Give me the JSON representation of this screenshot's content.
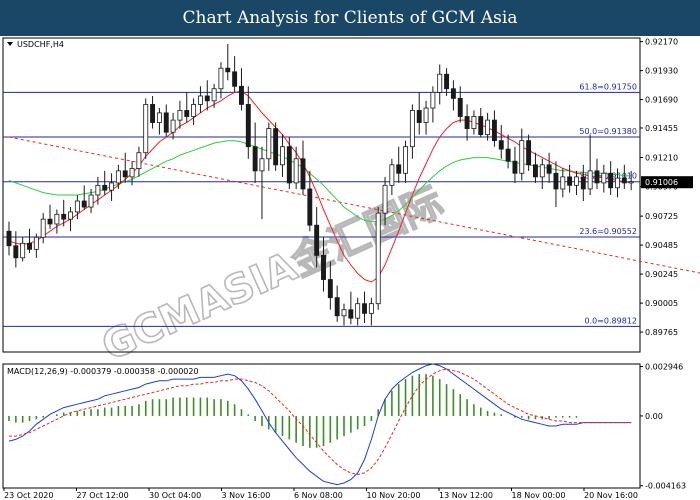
{
  "header": {
    "title": "Chart Analysis for Clients of GCM Asia"
  },
  "chart_data": {
    "type": "candlestick",
    "symbol_label": "USDCHF,H4",
    "watermark": "GCMASIA金汇国际",
    "price_axis": {
      "ylim": [
        0.896,
        0.922
      ],
      "ticks": [
        "0.92170",
        "0.91930",
        "0.91690",
        "0.91455",
        "0.91210",
        "0.90970",
        "0.90725",
        "0.90485",
        "0.90245",
        "0.90005",
        "0.89765"
      ]
    },
    "current_price": "0.91006",
    "fibonacci": [
      {
        "label": "61.8=0.91750",
        "price": 0.9175
      },
      {
        "label": "50.0=0.91380",
        "price": 0.9138
      },
      {
        "label": "38.2=0.91010",
        "price": 0.9101
      },
      {
        "label": "23.6=0.90552",
        "price": 0.90552
      },
      {
        "label": "0.0=0.89812",
        "price": 0.89812
      }
    ],
    "trendline": {
      "from": [
        0,
        0.9138
      ],
      "to": [
        140,
        0.8982
      ]
    },
    "candles": [
      [
        0.906,
        0.9068,
        0.904,
        0.9048
      ],
      [
        0.9048,
        0.906,
        0.903,
        0.9038
      ],
      [
        0.9038,
        0.9055,
        0.9035,
        0.905
      ],
      [
        0.905,
        0.9062,
        0.9042,
        0.9045
      ],
      [
        0.9045,
        0.9058,
        0.9038,
        0.9055
      ],
      [
        0.9055,
        0.9075,
        0.905,
        0.907
      ],
      [
        0.907,
        0.9082,
        0.9062,
        0.9066
      ],
      [
        0.9066,
        0.9078,
        0.9058,
        0.9074
      ],
      [
        0.9074,
        0.9086,
        0.9064,
        0.907
      ],
      [
        0.907,
        0.908,
        0.906,
        0.9076
      ],
      [
        0.9076,
        0.909,
        0.907,
        0.9085
      ],
      [
        0.9085,
        0.9098,
        0.9078,
        0.908
      ],
      [
        0.908,
        0.9095,
        0.9075,
        0.909
      ],
      [
        0.909,
        0.9105,
        0.9082,
        0.9098
      ],
      [
        0.9098,
        0.911,
        0.909,
        0.9094
      ],
      [
        0.9094,
        0.9108,
        0.9085,
        0.91
      ],
      [
        0.91,
        0.9115,
        0.9095,
        0.911
      ],
      [
        0.911,
        0.9125,
        0.91,
        0.9105
      ],
      [
        0.9105,
        0.9118,
        0.9098,
        0.9112
      ],
      [
        0.9112,
        0.913,
        0.9105,
        0.9125
      ],
      [
        0.9125,
        0.917,
        0.912,
        0.9165
      ],
      [
        0.9165,
        0.9172,
        0.9145,
        0.915
      ],
      [
        0.915,
        0.9162,
        0.914,
        0.9158
      ],
      [
        0.9158,
        0.9165,
        0.9138,
        0.9142
      ],
      [
        0.9142,
        0.9158,
        0.9136,
        0.9152
      ],
      [
        0.9152,
        0.9168,
        0.9145,
        0.916
      ],
      [
        0.916,
        0.9175,
        0.915,
        0.9155
      ],
      [
        0.9155,
        0.917,
        0.9148,
        0.9165
      ],
      [
        0.9165,
        0.918,
        0.9158,
        0.9172
      ],
      [
        0.9172,
        0.9185,
        0.916,
        0.9168
      ],
      [
        0.9168,
        0.9182,
        0.9162,
        0.9178
      ],
      [
        0.9178,
        0.92,
        0.917,
        0.9195
      ],
      [
        0.9195,
        0.9215,
        0.9185,
        0.9192
      ],
      [
        0.9192,
        0.9205,
        0.9175,
        0.918
      ],
      [
        0.918,
        0.9195,
        0.916,
        0.9165
      ],
      [
        0.9165,
        0.918,
        0.912,
        0.913
      ],
      [
        0.913,
        0.915,
        0.91,
        0.911
      ],
      [
        0.911,
        0.913,
        0.907,
        0.912
      ],
      [
        0.912,
        0.915,
        0.911,
        0.9145
      ],
      [
        0.9145,
        0.915,
        0.911,
        0.9115
      ],
      [
        0.9115,
        0.914,
        0.9105,
        0.913
      ],
      [
        0.913,
        0.9138,
        0.9095,
        0.91
      ],
      [
        0.91,
        0.913,
        0.9095,
        0.912
      ],
      [
        0.912,
        0.9135,
        0.909,
        0.9095
      ],
      [
        0.9095,
        0.911,
        0.906,
        0.9065
      ],
      [
        0.9065,
        0.908,
        0.903,
        0.904
      ],
      [
        0.904,
        0.9055,
        0.901,
        0.902
      ],
      [
        0.902,
        0.9035,
        0.8995,
        0.9005
      ],
      [
        0.9005,
        0.9015,
        0.8985,
        0.899
      ],
      [
        0.899,
        0.9,
        0.8982,
        0.8995
      ],
      [
        0.8995,
        0.901,
        0.8983,
        0.8988
      ],
      [
        0.8988,
        0.9005,
        0.8982,
        0.9
      ],
      [
        0.9,
        0.901,
        0.8984,
        0.8992
      ],
      [
        0.8992,
        0.9005,
        0.8982,
        0.9
      ],
      [
        0.9,
        0.908,
        0.8995,
        0.9075
      ],
      [
        0.9075,
        0.9105,
        0.9065,
        0.9098
      ],
      [
        0.9098,
        0.912,
        0.909,
        0.9115
      ],
      [
        0.9115,
        0.913,
        0.91,
        0.9108
      ],
      [
        0.9108,
        0.9135,
        0.91,
        0.913
      ],
      [
        0.913,
        0.9165,
        0.912,
        0.916
      ],
      [
        0.916,
        0.9175,
        0.914,
        0.915
      ],
      [
        0.915,
        0.9168,
        0.914,
        0.9162
      ],
      [
        0.9162,
        0.918,
        0.915,
        0.9175
      ],
      [
        0.9175,
        0.9198,
        0.9165,
        0.919
      ],
      [
        0.919,
        0.9195,
        0.9172,
        0.9178
      ],
      [
        0.9178,
        0.9185,
        0.916,
        0.917
      ],
      [
        0.917,
        0.918,
        0.915,
        0.9155
      ],
      [
        0.9155,
        0.9165,
        0.9135,
        0.9145
      ],
      [
        0.9145,
        0.916,
        0.914,
        0.9155
      ],
      [
        0.9155,
        0.9162,
        0.9138,
        0.914
      ],
      [
        0.914,
        0.9158,
        0.9135,
        0.9152
      ],
      [
        0.9152,
        0.916,
        0.913,
        0.9135
      ],
      [
        0.9135,
        0.9148,
        0.912,
        0.9128
      ],
      [
        0.9128,
        0.914,
        0.9112,
        0.9118
      ],
      [
        0.9118,
        0.913,
        0.91,
        0.9108
      ],
      [
        0.9108,
        0.9145,
        0.9102,
        0.9135
      ],
      [
        0.9135,
        0.914,
        0.911,
        0.9115
      ],
      [
        0.9115,
        0.9125,
        0.91,
        0.9105
      ],
      [
        0.9105,
        0.912,
        0.9095,
        0.9115
      ],
      [
        0.9115,
        0.9125,
        0.91,
        0.9108
      ],
      [
        0.9108,
        0.9118,
        0.908,
        0.9095
      ],
      [
        0.9095,
        0.9112,
        0.9088,
        0.9105
      ],
      [
        0.9105,
        0.9115,
        0.9092,
        0.9098
      ],
      [
        0.9098,
        0.911,
        0.909,
        0.9105
      ],
      [
        0.9105,
        0.9115,
        0.9085,
        0.9095
      ],
      [
        0.9095,
        0.914,
        0.909,
        0.911
      ],
      [
        0.911,
        0.912,
        0.9095,
        0.91
      ],
      [
        0.91,
        0.9115,
        0.9092,
        0.9108
      ],
      [
        0.9108,
        0.9118,
        0.909,
        0.9096
      ],
      [
        0.9096,
        0.9112,
        0.9088,
        0.9104
      ],
      [
        0.9104,
        0.9115,
        0.9095,
        0.91
      ],
      [
        0.91,
        0.911,
        0.9094,
        0.9101
      ]
    ],
    "ma_red": [
      0.9052,
      0.905,
      0.9049,
      0.905,
      0.9052,
      0.9056,
      0.906,
      0.9064,
      0.9067,
      0.907,
      0.9074,
      0.9078,
      0.9082,
      0.9086,
      0.909,
      0.9094,
      0.9098,
      0.9103,
      0.9108,
      0.9114,
      0.9122,
      0.9128,
      0.9134,
      0.9138,
      0.9142,
      0.9147,
      0.915,
      0.9154,
      0.9158,
      0.9162,
      0.9165,
      0.9168,
      0.9172,
      0.9175,
      0.9176,
      0.9172,
      0.9165,
      0.9158,
      0.9152,
      0.9146,
      0.914,
      0.9132,
      0.9125,
      0.9116,
      0.9105,
      0.9092,
      0.9078,
      0.9065,
      0.9052,
      0.904,
      0.9032,
      0.9025,
      0.902,
      0.9018,
      0.9022,
      0.9032,
      0.9046,
      0.906,
      0.9075,
      0.909,
      0.9104,
      0.9116,
      0.9128,
      0.9138,
      0.9145,
      0.915,
      0.9152,
      0.9152,
      0.915,
      0.9148,
      0.9146,
      0.9143,
      0.914,
      0.9137,
      0.9134,
      0.913,
      0.9127,
      0.9124,
      0.9121,
      0.9118,
      0.9115,
      0.9112,
      0.911,
      0.9108,
      0.9107,
      0.9106,
      0.9105,
      0.9104,
      0.9103,
      0.9102,
      0.9101,
      0.91
    ],
    "ma_green": [
      0.9102,
      0.91,
      0.9098,
      0.9096,
      0.9094,
      0.9092,
      0.9091,
      0.909,
      0.909,
      0.909,
      0.909,
      0.9091,
      0.9092,
      0.9093,
      0.9095,
      0.9097,
      0.9099,
      0.9101,
      0.9103,
      0.9106,
      0.9109,
      0.9112,
      0.9115,
      0.9118,
      0.912,
      0.9123,
      0.9125,
      0.9127,
      0.9129,
      0.9131,
      0.9133,
      0.9134,
      0.9135,
      0.9135,
      0.9134,
      0.9132,
      0.913,
      0.9128,
      0.9126,
      0.9124,
      0.9122,
      0.9119,
      0.9116,
      0.9113,
      0.9108,
      0.9103,
      0.9098,
      0.9092,
      0.9086,
      0.908,
      0.9076,
      0.9072,
      0.9069,
      0.9068,
      0.9068,
      0.907,
      0.9073,
      0.9077,
      0.9082,
      0.9088,
      0.9094,
      0.91,
      0.9105,
      0.911,
      0.9114,
      0.9117,
      0.9119,
      0.912,
      0.9121,
      0.9121,
      0.9121,
      0.912,
      0.9119,
      0.9118,
      0.9117,
      0.9116,
      0.9115,
      0.9114,
      0.9113,
      0.9112,
      0.9111,
      0.911,
      0.911,
      0.9109,
      0.9109,
      0.9108,
      0.9108,
      0.9108,
      0.9107,
      0.9107,
      0.9106,
      0.9106
    ],
    "macd": {
      "label": "MACD(12,26,9) -0.000379 -0.000358 -0.000020",
      "ylim": [
        -0.0043,
        0.0031
      ],
      "ticks": [
        "0.002946",
        "0.00",
        "-0.004163"
      ],
      "histogram": [
        -0.0003,
        -0.0004,
        -0.0004,
        -0.0003,
        -0.0002,
        -0.0001,
        0.0,
        0.0001,
        0.0002,
        0.0002,
        0.0003,
        0.0003,
        0.0004,
        0.0004,
        0.0005,
        0.0005,
        0.0006,
        0.0006,
        0.0006,
        0.0007,
        0.0009,
        0.001,
        0.001,
        0.001,
        0.0011,
        0.0011,
        0.0011,
        0.0011,
        0.0011,
        0.0011,
        0.001,
        0.001,
        0.0009,
        0.0007,
        0.0004,
        0.0001,
        -0.0003,
        -0.0006,
        -0.0008,
        -0.001,
        -0.0012,
        -0.0014,
        -0.0016,
        -0.0018,
        -0.0019,
        -0.0019,
        -0.0018,
        -0.0016,
        -0.0014,
        -0.0012,
        -0.001,
        -0.0008,
        -0.0006,
        -0.0003,
        0.0004,
        0.001,
        0.0015,
        0.0019,
        0.0022,
        0.0024,
        0.0025,
        0.0025,
        0.0024,
        0.0022,
        0.0019,
        0.0016,
        0.0013,
        0.001,
        0.0007,
        0.0005,
        0.0003,
        0.0002,
        0.0001,
        0.0,
        -0.0001,
        -0.0001,
        -0.0002,
        -0.0002,
        -0.0002,
        -0.0002,
        -0.0001,
        -0.0001,
        -0.0001,
        -0.0001,
        0.0,
        0.0,
        0.0,
        0.0,
        0.0,
        0.0,
        0.0,
        0.0
      ],
      "macd_line": [
        -0.0015,
        -0.0014,
        -0.0012,
        -0.0009,
        -0.0005,
        -0.0002,
        0.0001,
        0.0003,
        0.0005,
        0.0006,
        0.0007,
        0.0008,
        0.0009,
        0.001,
        0.0012,
        0.0013,
        0.0014,
        0.0015,
        0.0016,
        0.0017,
        0.0019,
        0.002,
        0.0021,
        0.0021,
        0.0022,
        0.0022,
        0.0022,
        0.0022,
        0.0023,
        0.0023,
        0.0023,
        0.0024,
        0.0025,
        0.0024,
        0.0021,
        0.0016,
        0.001,
        0.0003,
        -0.0004,
        -0.001,
        -0.0015,
        -0.002,
        -0.0025,
        -0.0029,
        -0.0033,
        -0.0036,
        -0.0039,
        -0.004,
        -0.0041,
        -0.004,
        -0.0038,
        -0.0034,
        -0.0026,
        -0.0014,
        0.0,
        0.001,
        0.0016,
        0.002,
        0.0023,
        0.0026,
        0.0028,
        0.003,
        0.0031,
        0.003,
        0.0028,
        0.0025,
        0.0022,
        0.0019,
        0.0016,
        0.0013,
        0.001,
        0.0007,
        0.0004,
        0.0002,
        0.0,
        -0.0002,
        -0.0003,
        -0.0004,
        -0.0005,
        -0.0006,
        -0.0006,
        -0.0005,
        -0.0005,
        -0.0005,
        -0.0004,
        -0.0004,
        -0.0004,
        -0.0004,
        -0.0004,
        -0.0004,
        -0.0004,
        -0.0004
      ],
      "signal_line": [
        -0.0012,
        -0.0012,
        -0.0011,
        -0.001,
        -0.0008,
        -0.0006,
        -0.0004,
        -0.0002,
        0.0,
        0.0002,
        0.0003,
        0.0004,
        0.0005,
        0.0006,
        0.0007,
        0.0008,
        0.0009,
        0.001,
        0.0011,
        0.0012,
        0.0013,
        0.0014,
        0.0015,
        0.0016,
        0.0017,
        0.0018,
        0.0018,
        0.0019,
        0.0019,
        0.002,
        0.002,
        0.0021,
        0.0021,
        0.0022,
        0.0022,
        0.0021,
        0.002,
        0.0018,
        0.0015,
        0.0011,
        0.0007,
        0.0003,
        -0.0002,
        -0.0006,
        -0.0011,
        -0.0016,
        -0.0021,
        -0.0025,
        -0.0029,
        -0.0032,
        -0.0034,
        -0.0035,
        -0.0034,
        -0.0031,
        -0.0026,
        -0.0019,
        -0.0011,
        -0.0003,
        0.0005,
        0.0012,
        0.0018,
        0.0022,
        0.0025,
        0.0027,
        0.0028,
        0.0027,
        0.0026,
        0.0024,
        0.0022,
        0.0019,
        0.0016,
        0.0013,
        0.001,
        0.0007,
        0.0005,
        0.0003,
        0.0001,
        0.0,
        -0.0001,
        -0.0002,
        -0.0003,
        -0.0003,
        -0.0004,
        -0.0004,
        -0.0004,
        -0.0004,
        -0.0004,
        -0.0004,
        -0.0004,
        -0.0004,
        -0.0004,
        -0.0004
      ]
    },
    "x_labels": [
      "23 Oct 2020",
      "27 Oct 12:00",
      "30 Oct 04:00",
      "3 Nov 16:00",
      "6 Nov 08:00",
      "10 Nov 20:00",
      "13 Nov 12:00",
      "18 Nov 00:00",
      "20 Nov 16:00"
    ],
    "colors": {
      "candle": "#1a1a1a",
      "ma_red": "#e8262a",
      "ma_green": "#2ecc40",
      "fibo": "#1f2a9a",
      "trendline": "#e8262a",
      "macd_hist": "#3c8c28",
      "macd_line": "#1f3fd0",
      "signal_line": "#e8262a",
      "price_tag_bg": "#000000"
    }
  }
}
